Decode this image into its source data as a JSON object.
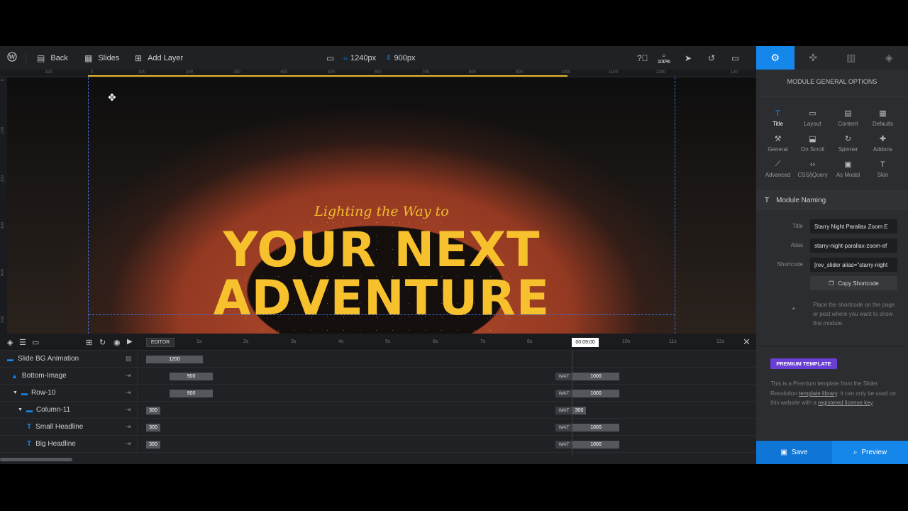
{
  "toolbar": {
    "back_label": "Back",
    "slides_label": "Slides",
    "add_layer_label": "Add Layer",
    "width_value": "1240px",
    "height_value": "900px",
    "zoom_value": "100%"
  },
  "ruler": {
    "h_marks": [
      "-100",
      "0",
      "100",
      "200",
      "300",
      "400",
      "500",
      "600",
      "700",
      "800",
      "900",
      "1000",
      "1100",
      "1200",
      "130"
    ],
    "v_marks": [
      "0",
      "100",
      "200",
      "300",
      "400",
      "500"
    ]
  },
  "canvas": {
    "small_headline": "Lighting the Way to",
    "big_headline_line1": "YOUR NEXT",
    "big_headline_line2": "ADVENTURE",
    "headline_color": "#f6c12c"
  },
  "timeline": {
    "editor_label": "EDITOR",
    "ticks": [
      "1s",
      "2s",
      "3s",
      "4s",
      "5s",
      "6s",
      "7s",
      "8s",
      "00:09:00",
      "10s",
      "11s",
      "12s"
    ],
    "layers": [
      {
        "name": "Slide BG Animation",
        "duration": "1200"
      },
      {
        "name": "Bottom-Image",
        "duration": "900",
        "wait": "WAIT",
        "out": "1000"
      },
      {
        "name": "Row-10",
        "duration": "900",
        "wait": "WAIT",
        "out": "1000"
      },
      {
        "name": "Column-11",
        "duration": "300",
        "wait": "WAIT",
        "out": "300"
      },
      {
        "name": "Small Headline",
        "duration": "300",
        "wait": "WAIT",
        "out": "1000"
      },
      {
        "name": "Big Headline",
        "duration": "300",
        "wait": "WAIT",
        "out": "1000"
      }
    ]
  },
  "panel": {
    "title": "MODULE GENERAL OPTIONS",
    "options": [
      "Title",
      "Layout",
      "Content",
      "Defaults",
      "General",
      "On Scroll",
      "Spinner",
      "Addons",
      "Advanced",
      "CSS/jQuery",
      "As Modal",
      "Skin"
    ],
    "section_title": "Module Naming",
    "title_label": "Title",
    "title_value": "Starry Night Parallax Zoom E",
    "alias_label": "Alias",
    "alias_value": "starry-night-parallax-zoom-ef",
    "shortcode_label": "Shortcode",
    "shortcode_value": "[rev_slider alias=\"starry-night",
    "copy_label": "Copy Shortcode",
    "hint": "Place the shortcode on the page or post where you want to show this module.",
    "premium_badge": "PREMIUM TEMPLATE",
    "premium_text_1": "This is a Premium template from the Slider Revolution",
    "premium_link_1": "template library",
    "premium_text_2": ". It can only be used on this website with a",
    "premium_link_2": "registered license key",
    "premium_text_3": "."
  },
  "footer": {
    "save_label": "Save",
    "preview_label": "Preview"
  },
  "colors": {
    "accent": "#1587ea",
    "premium": "#6a3fd6"
  }
}
